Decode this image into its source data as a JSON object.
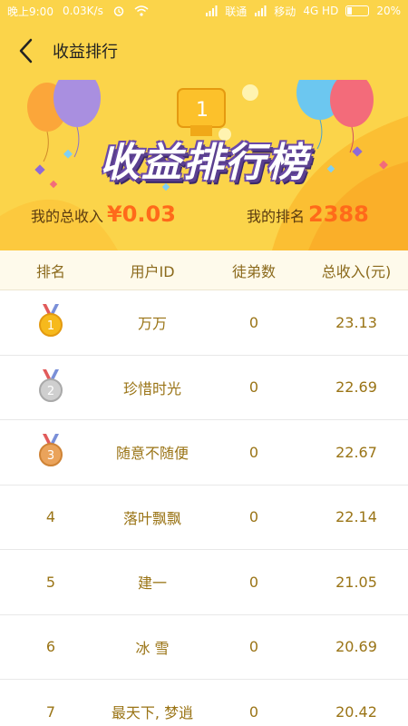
{
  "status": {
    "time": "晚上9:00",
    "speed": "0.03K/s",
    "carrier1": "联通",
    "carrier2": "移动",
    "network": "4G HD",
    "battery": "20%",
    "battery_level": 0.2
  },
  "header": {
    "title": "收益排行",
    "back_icon": "chevron-left-icon"
  },
  "banner": {
    "title": "收益排行榜",
    "income_label": "我的总收入",
    "income_value": "¥0.03",
    "rank_label": "我的排名",
    "rank_value": "2388"
  },
  "table": {
    "headers": [
      "排名",
      "用户ID",
      "徒弟数",
      "总收入(元)"
    ],
    "rows": [
      {
        "rank": "1",
        "user": "万万",
        "apprentices": "0",
        "income": "23.13",
        "medal": "gold-medal-icon"
      },
      {
        "rank": "2",
        "user": "珍惜时光",
        "apprentices": "0",
        "income": "22.69",
        "medal": "silver-medal-icon"
      },
      {
        "rank": "3",
        "user": "随意不随便",
        "apprentices": "0",
        "income": "22.67",
        "medal": "bronze-medal-icon"
      },
      {
        "rank": "4",
        "user": "落叶飘飘",
        "apprentices": "0",
        "income": "22.14"
      },
      {
        "rank": "5",
        "user": "建一",
        "apprentices": "0",
        "income": "21.05"
      },
      {
        "rank": "6",
        "user": "冰 雪",
        "apprentices": "0",
        "income": "20.69"
      },
      {
        "rank": "7",
        "user": "最天下, 梦逍",
        "apprentices": "0",
        "income": "20.42"
      }
    ]
  },
  "colors": {
    "brand": "#fbd44a",
    "accent": "#ff6a1a",
    "text_gold": "#9a7416"
  }
}
